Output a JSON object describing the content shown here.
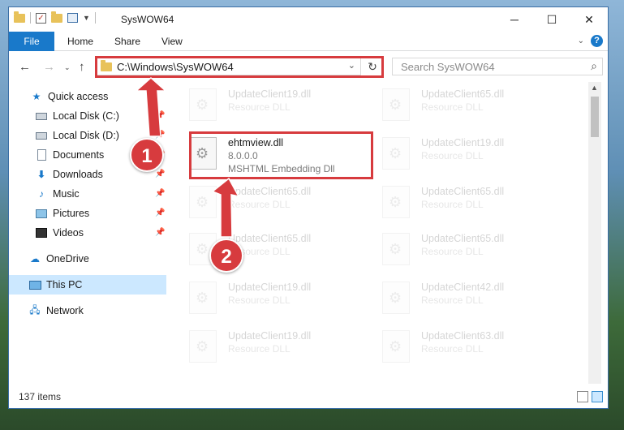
{
  "window": {
    "title": "SysWOW64",
    "controls": {
      "minimize": "─",
      "maximize": "☐",
      "close": "✕"
    }
  },
  "ribbon": {
    "tabs": [
      "File",
      "Home",
      "Share",
      "View"
    ],
    "help": "?"
  },
  "address": {
    "path": "C:\\Windows\\SysWOW64",
    "search_placeholder": "Search SysWOW64"
  },
  "nav": {
    "items": [
      {
        "label": "Quick access",
        "icon": "star-icon",
        "pinned": false
      },
      {
        "label": "Local Disk (C:)",
        "icon": "disk-icon",
        "pinned": true
      },
      {
        "label": "Local Disk (D:)",
        "icon": "disk-icon",
        "pinned": true
      },
      {
        "label": "Documents",
        "icon": "documents-icon",
        "pinned": true
      },
      {
        "label": "Downloads",
        "icon": "downloads-icon",
        "pinned": true
      },
      {
        "label": "Music",
        "icon": "music-icon",
        "pinned": true
      },
      {
        "label": "Pictures",
        "icon": "pictures-icon",
        "pinned": true
      },
      {
        "label": "Videos",
        "icon": "videos-icon",
        "pinned": true
      },
      {
        "label": "OneDrive",
        "icon": "onedrive-icon",
        "pinned": false
      },
      {
        "label": "This PC",
        "icon": "pc-icon",
        "pinned": false,
        "selected": true
      },
      {
        "label": "Network",
        "icon": "network-icon",
        "pinned": false
      }
    ]
  },
  "files": {
    "highlighted": {
      "name": "ehtmview.dll",
      "version": "8.0.0.0",
      "description": "MSHTML Embedding Dll"
    },
    "left_column": [
      {
        "name": "UpdateClient19.dll",
        "type": "Resource DLL"
      },
      {
        "name": "UpdateClient65.dll",
        "type": "Resource DLL"
      },
      {
        "name": "UpdateClient65.dll",
        "type": "Resource DLL"
      },
      {
        "name": "UpdateClient19.dll",
        "type": "Resource DLL"
      },
      {
        "name": "UpdateClient19.dll",
        "type": "Resource DLL"
      }
    ],
    "right_column": [
      {
        "name": "UpdateClient65.dll",
        "type": "Resource DLL"
      },
      {
        "name": "UpdateClient19.dll",
        "type": "Resource DLL"
      },
      {
        "name": "UpdateClient65.dll",
        "type": "Resource DLL"
      },
      {
        "name": "UpdateClient65.dll",
        "type": "Resource DLL"
      },
      {
        "name": "UpdateClient42.dll",
        "type": "Resource DLL"
      },
      {
        "name": "UpdateClient63.dll",
        "type": "Resource DLL"
      }
    ]
  },
  "status": {
    "items": "137 items"
  },
  "callouts": {
    "one": "1",
    "two": "2"
  },
  "colors": {
    "accent": "#1979ca",
    "highlight": "#d73b3e"
  }
}
